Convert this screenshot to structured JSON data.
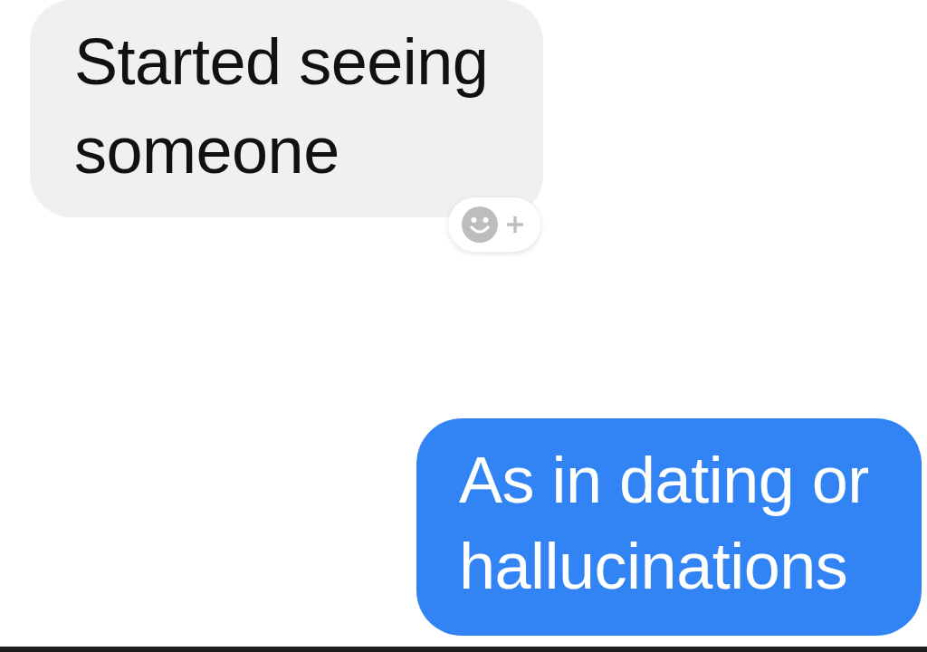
{
  "messages": [
    {
      "kind": "received",
      "text": "Started seeing someone",
      "reaction_button": true
    },
    {
      "kind": "sent",
      "text": "As in dating or hallucinations"
    }
  ]
}
